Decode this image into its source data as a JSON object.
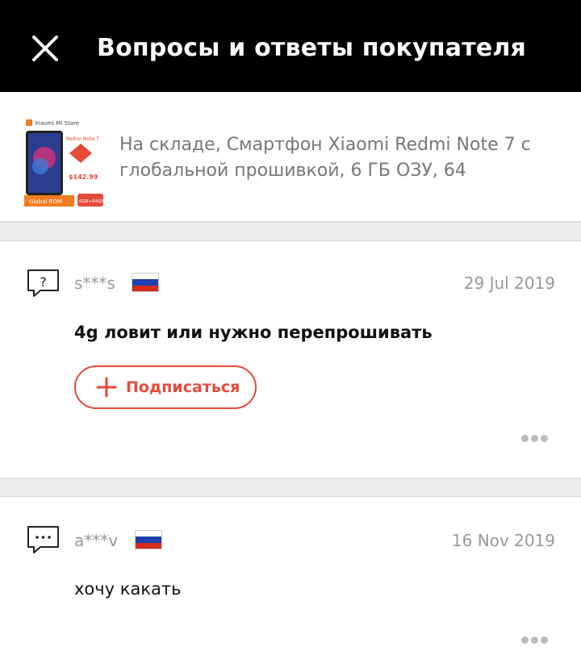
{
  "header": {
    "title": "Вопросы и ответы покупателя",
    "close_icon": "close-icon"
  },
  "product": {
    "description": "На складе, Смартфон Xiaomi Redmi Note 7 с глобальной прошивкой, 6 ГБ ОЗУ, 64",
    "thumb": {
      "store": "Xiaomi Mi Store",
      "model": "Redmi Note 7",
      "price": "$142.99",
      "rom": "Global ROM",
      "mem": "6GB+64GB"
    }
  },
  "questions": [
    {
      "user": "s***s",
      "date": "29 Jul 2019",
      "text": "4g ловит или нужно перепрошивать",
      "icon": "question-bubble-icon"
    },
    {
      "user": "a***v",
      "date": "16 Nov 2019",
      "text": "хочу какать",
      "icon": "chat-bubble-icon"
    }
  ],
  "subscribe": {
    "label": "Подписаться"
  },
  "colors": {
    "header_bg": "#000000",
    "accent": "#e64a3b",
    "muted": "#999999"
  }
}
